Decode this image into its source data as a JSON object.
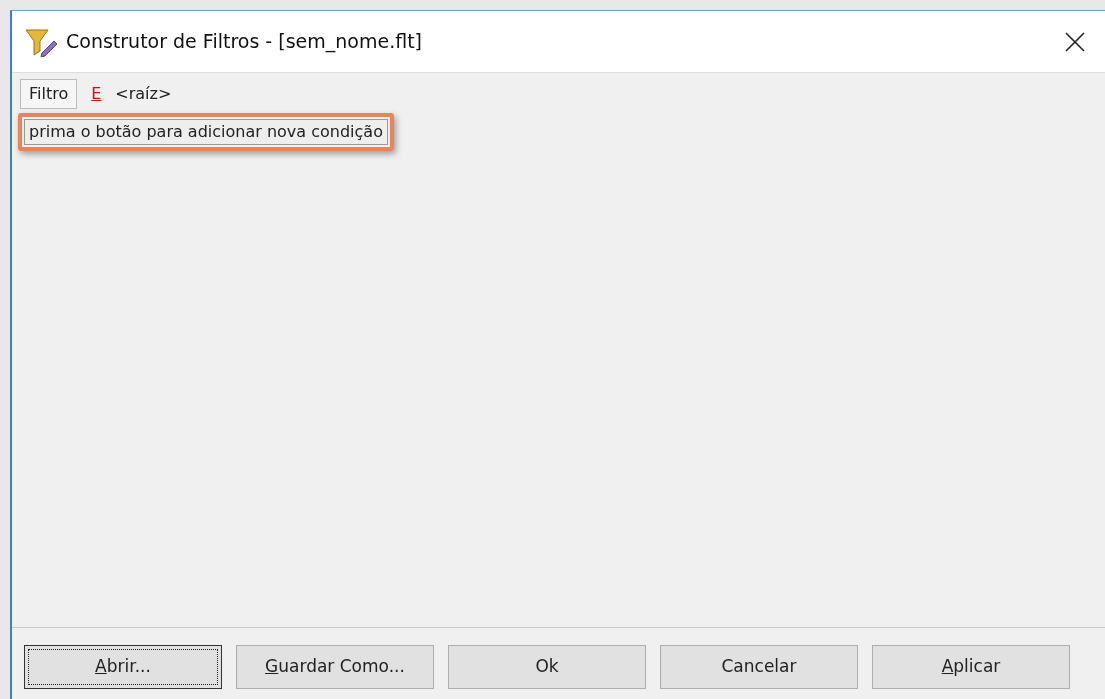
{
  "window": {
    "title": "Construtor de Filtros - [sem_nome.flt]"
  },
  "filter_bar": {
    "tab": "Filtro",
    "operator": "E",
    "node": "<raíz>"
  },
  "hint": "prima o botão para adicionar nova condição",
  "buttons": [
    {
      "access_key": "A",
      "label_rest": "brir...",
      "focused": true
    },
    {
      "access_key": "G",
      "label_rest": "uardar Como...",
      "focused": false
    },
    {
      "label": "Ok",
      "focused": false
    },
    {
      "label": "Cancelar",
      "focused": false
    },
    {
      "access_key": "A",
      "label_rest": "plicar",
      "focused": false
    }
  ]
}
